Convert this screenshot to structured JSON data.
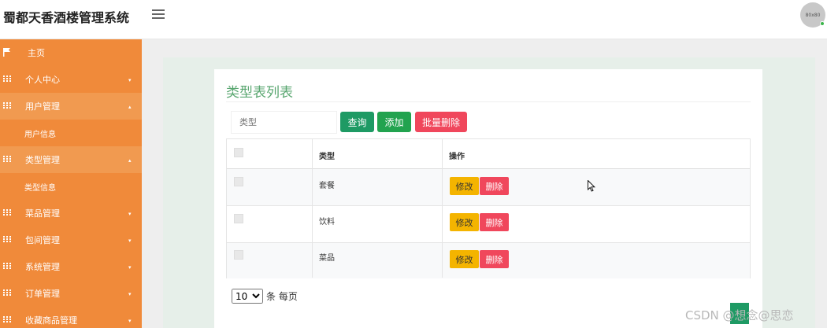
{
  "header": {
    "app_title": "蜀都天香酒楼管理系统",
    "avatar_text": "80x80"
  },
  "sidebar": {
    "items": [
      {
        "label": "主页",
        "icon": "flag-icon"
      },
      {
        "label": "个人中心",
        "icon": "grid-icon",
        "caret": "▾"
      },
      {
        "label": "用户管理",
        "icon": "grid-icon",
        "caret": "▴"
      },
      {
        "label": "用户信息"
      },
      {
        "label": "类型管理",
        "icon": "grid-icon",
        "caret": "▴"
      },
      {
        "label": "类型信息"
      },
      {
        "label": "菜品管理",
        "icon": "grid-icon",
        "caret": "▾"
      },
      {
        "label": "包间管理",
        "icon": "grid-icon",
        "caret": "▾"
      },
      {
        "label": "系统管理",
        "icon": "grid-icon",
        "caret": "▾"
      },
      {
        "label": "订单管理",
        "icon": "grid-icon",
        "caret": "▾"
      },
      {
        "label": "收藏商品管理",
        "icon": "grid-icon",
        "caret": "▾"
      }
    ]
  },
  "main": {
    "title": "类型表列表",
    "search": {
      "placeholder": "类型",
      "value": ""
    },
    "buttons": {
      "query": "查询",
      "add": "添加",
      "batch_delete": "批量删除"
    },
    "table": {
      "columns": [
        "类型",
        "操作"
      ],
      "rows": [
        {
          "type": "套餐",
          "edit": "修改",
          "delete": "删除"
        },
        {
          "type": "饮料",
          "edit": "修改",
          "delete": "删除"
        },
        {
          "type": "菜品",
          "edit": "修改",
          "delete": "删除"
        }
      ]
    },
    "pagination": {
      "page_size": "10",
      "suffix": "条 每页"
    }
  },
  "watermark": "CSDN @想念@思恋",
  "colors": {
    "sidebar": "#f08a3a",
    "title_green": "#58a66f",
    "query_button": "#1e9a64",
    "add_button": "#22a34f",
    "delete_button": "#f0475c",
    "edit_button": "#f4b400"
  }
}
